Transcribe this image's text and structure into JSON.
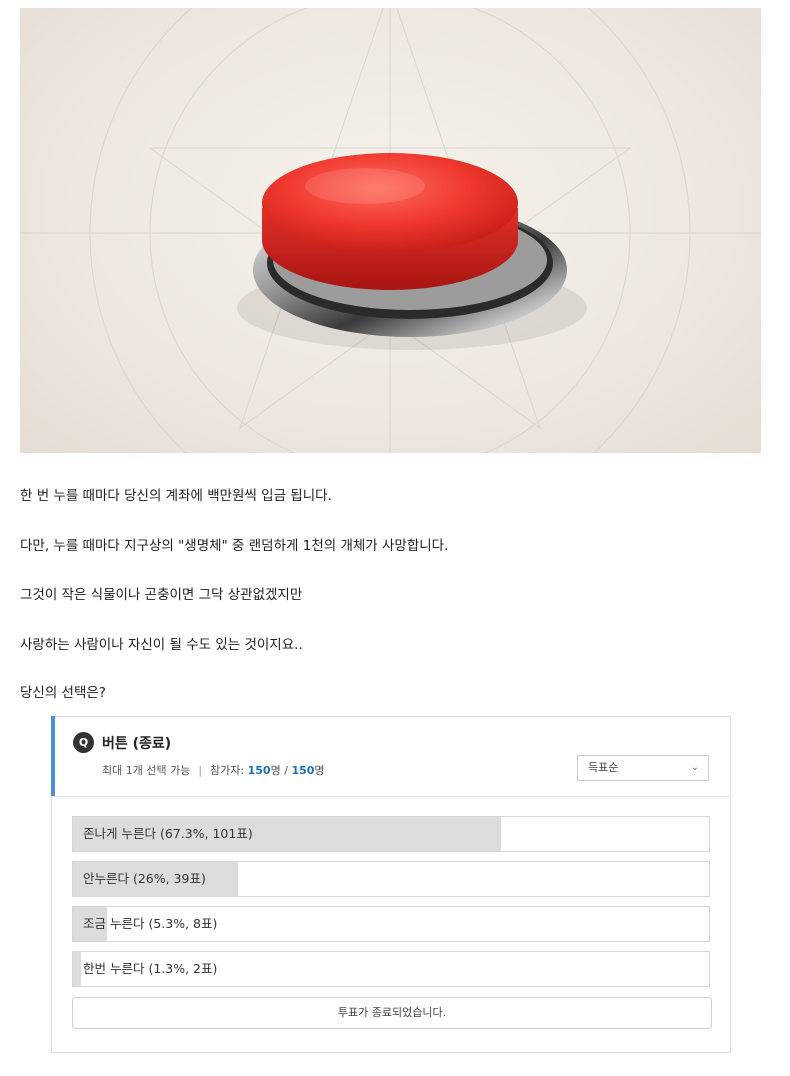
{
  "post": {
    "image_alt": "red button",
    "paragraphs": [
      "한 번 누를 때마다 당신의 계좌에 백만원씩 입금 됩니다.",
      "다만, 누를 때마다 지구상의 \"생명체\" 중 랜덤하게 1천의 개체가 사망합니다.",
      "그것이 작은 식물이나 곤충이면 그닥 상관없겠지만",
      "사랑하는 사람이나 자신이 될 수도 있는 것이지요..",
      "당신의 선택은?"
    ]
  },
  "poll": {
    "badge": "Q",
    "title": "버튼 (종료)",
    "max_select": "최대 1개 선택 가능",
    "participants_label": "참가자:",
    "participants_count": "150",
    "participants_unit": "명",
    "participants_divider": "/",
    "participants_total": "150",
    "participants_total_unit": "명",
    "sort_label": "득표순",
    "options": [
      {
        "label": "존나게 누른다 (67.3%, 101표)",
        "percent": 67.3
      },
      {
        "label": "안누른다 (26%, 39표)",
        "percent": 26
      },
      {
        "label": "조금 누른다 (5.3%, 8표)",
        "percent": 5.3
      },
      {
        "label": "한번 누른다 (1.3%, 2표)",
        "percent": 1.3
      }
    ],
    "closed_label": "투표가 종료되었습니다."
  },
  "colors": {
    "accent": "#4a90d9",
    "count_highlight": "#1e6fb8",
    "bar_fill": "#dcdcdc",
    "button_red": "#e8332c"
  }
}
